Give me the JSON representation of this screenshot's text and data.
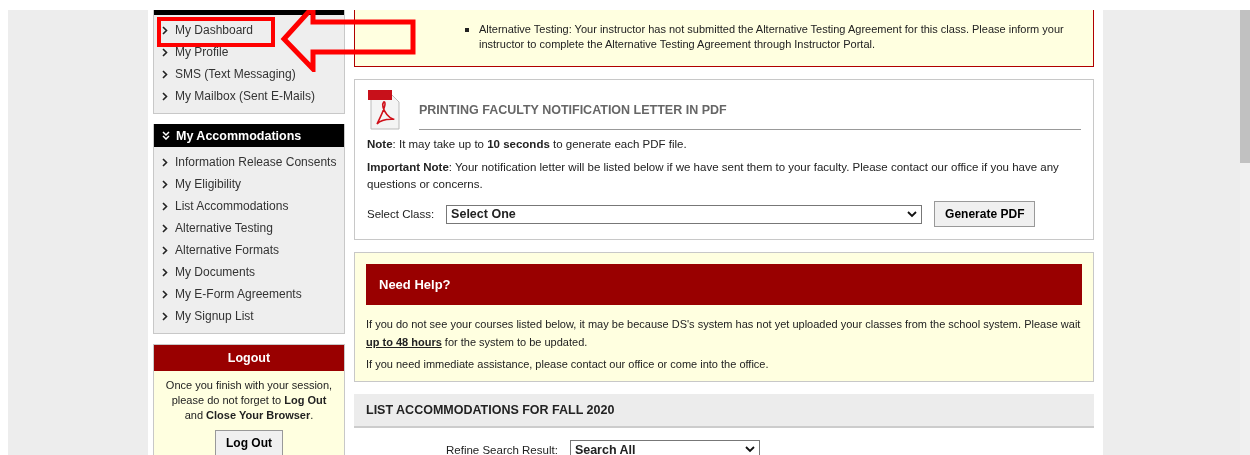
{
  "sidebar": {
    "menus": [
      {
        "items": [
          "My Dashboard",
          "My Profile",
          "SMS (Text Messaging)",
          "My Mailbox (Sent E-Mails)"
        ]
      },
      {
        "title": "My Accommodations",
        "items": [
          "Information Release Consents",
          "My Eligibility",
          "List Accommodations",
          "Alternative Testing",
          "Alternative Formats",
          "My Documents",
          "My E-Form Agreements",
          "My Signup List"
        ]
      }
    ],
    "logout": {
      "title": "Logout",
      "message": "Once you finish with your session, please do not forget to **Log Out** and **Close Your Browser**.",
      "button": "Log Out"
    }
  },
  "alert": {
    "items": [
      "Alternative Testing: Your instructor has not submitted the Alternative Testing Agreement for this class. Please inform your instructor to complete the Alternative Testing Agreement through Instructor Portal."
    ]
  },
  "pdf_panel": {
    "title": "PRINTING FACULTY NOTIFICATION LETTER IN PDF",
    "notes": [
      "**Note**: It may take up to **10 seconds** to generate each PDF file.",
      "**Important Note**: Your notification letter will be listed below if we have sent them to your faculty. Please contact our office if you have any questions or concerns."
    ],
    "select_label": "Select Class:",
    "select_value": "Select One",
    "button": "Generate PDF"
  },
  "help": {
    "title": "Need Help?",
    "paragraphs": [
      "If you do not see your courses listed below, it may be because DS's system has not yet uploaded your classes from the school system. Please wait **up to 48 hours** for the system to be updated.",
      "If you need immediate assistance, please contact our office or come into the office."
    ]
  },
  "list_section": {
    "title": "LIST ACCOMMODATIONS FOR FALL 2020",
    "filter_label": "Refine Search Result:",
    "filter_value": "Search All"
  }
}
